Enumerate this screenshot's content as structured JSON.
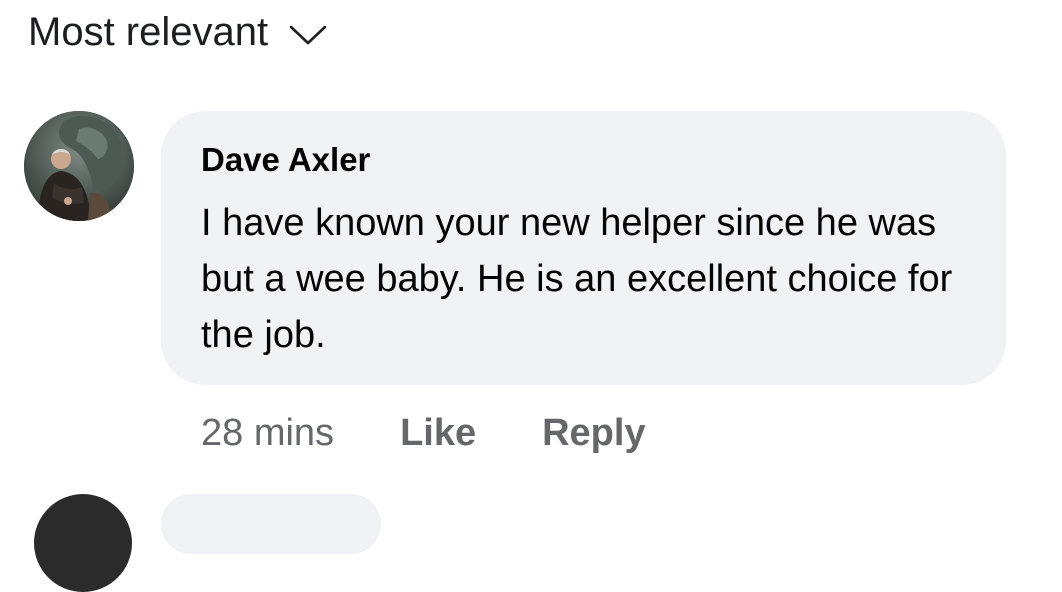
{
  "sort": {
    "label": "Most relevant",
    "icon": "chevron-down-icon"
  },
  "comment": {
    "author": "Dave Axler",
    "text": "I have known your new helper since he was but a wee baby. He is an excellent choice for the job.",
    "time": "28 mins",
    "like_label": "Like",
    "reply_label": "Reply"
  },
  "colors": {
    "bubble_bg": "#f0f2f5",
    "secondary_text": "#65676b",
    "primary_text": "#050505"
  }
}
